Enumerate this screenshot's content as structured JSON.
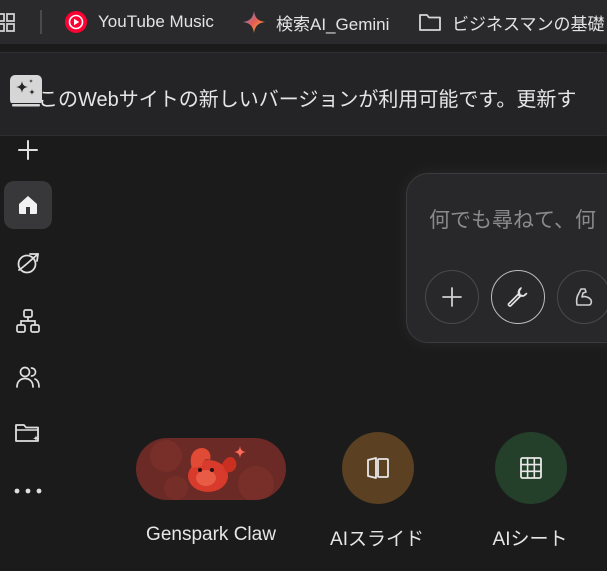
{
  "bookmarks": {
    "items": [
      {
        "label": "YouTube Music",
        "icon": "youtube-music-icon"
      },
      {
        "label": "検索AI_Gemini",
        "icon": "gemini-icon"
      },
      {
        "label": "ビジネスマンの基礎",
        "icon": "folder-icon"
      }
    ]
  },
  "banner": {
    "text": "このWebサイトの新しいバージョンが利用可能です。更新す"
  },
  "sidebar": {
    "items": [
      "new-icon",
      "home-icon",
      "explore-icon",
      "workflow-icon",
      "team-icon",
      "folder-icon",
      "more-icon"
    ]
  },
  "search": {
    "placeholder": "何でも尋ねて、何"
  },
  "tiles": [
    {
      "label": "Genspark Claw",
      "color": "#7a2a24"
    },
    {
      "label": "AIスライド",
      "color": "#5b4022"
    },
    {
      "label": "AIシート",
      "color": "#24402a"
    }
  ],
  "colors": {
    "background": "#1b1b1c",
    "bookmark_bar": "#2a2a2c",
    "banner": "#242426"
  }
}
